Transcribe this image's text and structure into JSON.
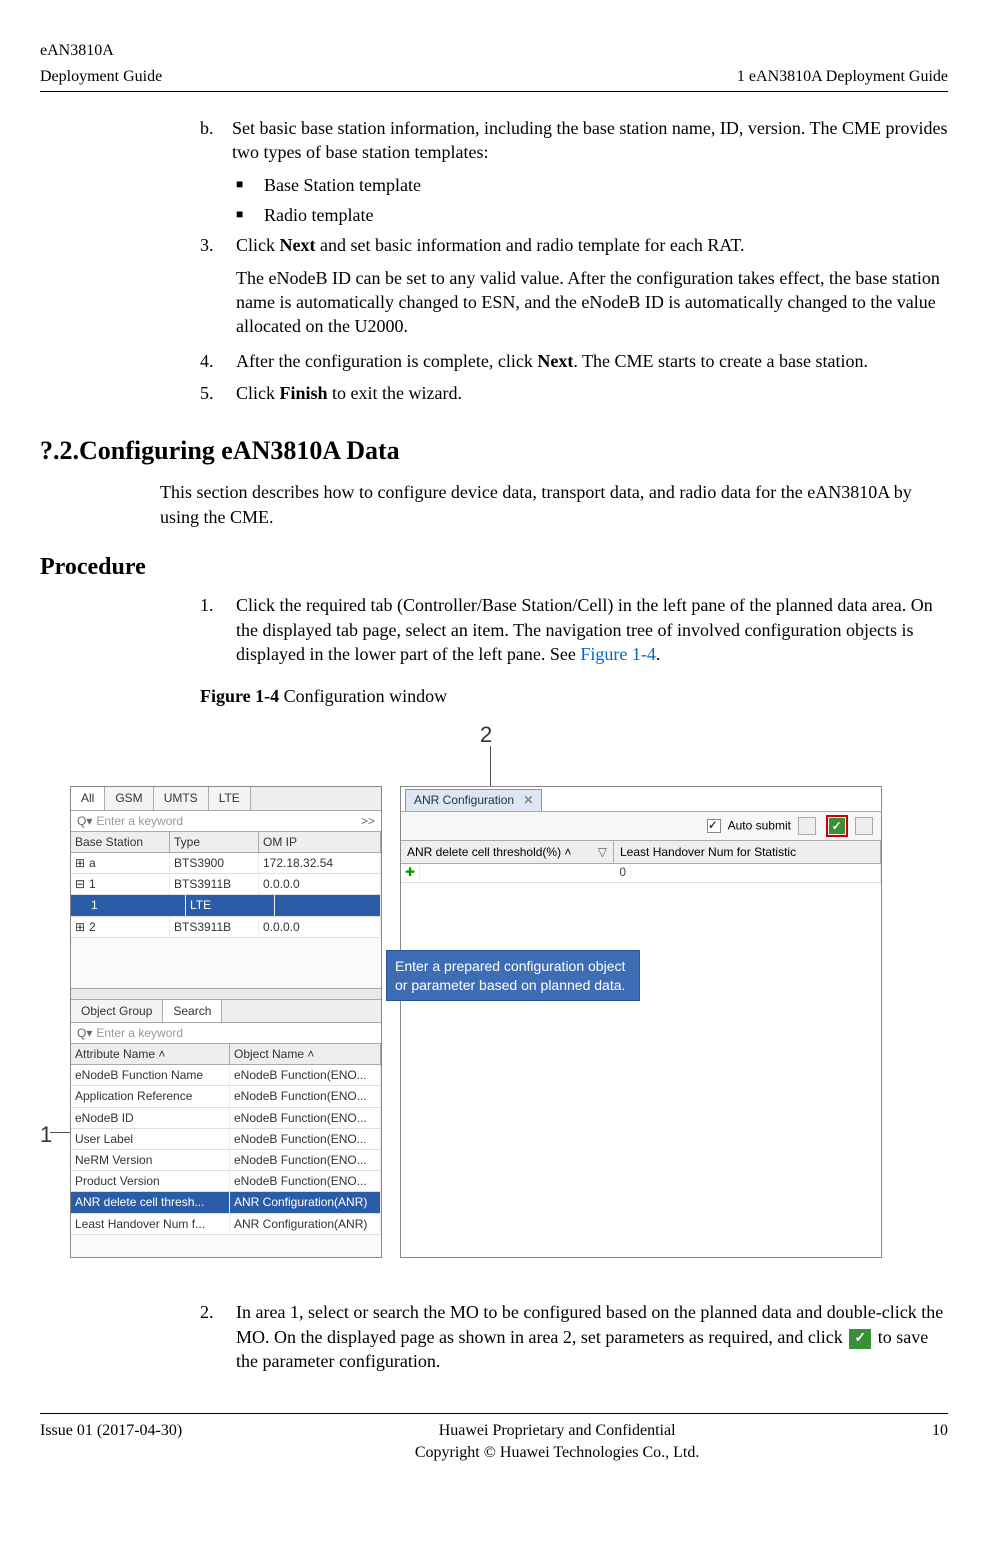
{
  "header": {
    "left_top": "eAN3810A",
    "left_bottom": "Deployment Guide",
    "right": "1 eAN3810A Deployment Guide"
  },
  "content": {
    "item_b": "Set basic base station information, including the base station name, ID, version. The CME provides two types of base station templates:",
    "bullet1": "Base Station template",
    "bullet2": "Radio template",
    "step3_pre": "Click ",
    "step3_bold": "Next",
    "step3_post": " and set basic information and radio template for each RAT.",
    "step3_para": "The eNodeB ID can be set to any valid value. After the configuration takes effect, the base station name is automatically changed to ESN, and the eNodeB ID is automatically changed to the value allocated on the U2000.",
    "step4_pre": "After the configuration is complete, click ",
    "step4_bold": "Next",
    "step4_post": ". The CME starts to create a base station.",
    "step5_pre": "Click ",
    "step5_bold": "Finish",
    "step5_post": " to exit the wizard."
  },
  "section2": {
    "heading": "?.2.Configuring eAN3810A Data",
    "para": "This section describes how to configure device data, transport data, and radio data for the eAN3810A by using the CME."
  },
  "procedure": {
    "heading": "Procedure",
    "step1": "Click the required tab (Controller/Base Station/Cell) in the left pane of the planned data area. On the displayed tab page, select an item. The navigation tree of involved configuration objects is displayed in the lower part of the left pane. See ",
    "step1_link": "Figure 1-4",
    "step1_post": ".",
    "fig_caption_bold": "Figure 1-4",
    "fig_caption_rest": " Configuration window",
    "step2_a": "In area 1, select or search the MO to be configured based on the planned data and double-click the MO. On the displayed page as shown in area 2, set parameters as required, and click ",
    "step2_b": "to save the parameter configuration."
  },
  "figure": {
    "tabs": {
      "all": "All",
      "gsm": "GSM",
      "umts": "UMTS",
      "lte": "LTE"
    },
    "search_q": "Q▾",
    "search_ph": "Enter a keyword",
    "expand": ">>",
    "cols": {
      "bs": "Base Station",
      "type": "Type",
      "omip": "OM IP"
    },
    "rows": [
      {
        "bs": "a",
        "type": "BTS3900",
        "ip": "172.18.32.54"
      },
      {
        "bs": "1",
        "type": "BTS3911B",
        "ip": "0.0.0.0"
      },
      {
        "bs": "1",
        "type": "LTE",
        "ip": ""
      },
      {
        "bs": "2",
        "type": "BTS3911B",
        "ip": "0.0.0.0"
      }
    ],
    "bottom_tabs": {
      "og": "Object Group",
      "search": "Search"
    },
    "attr_cols": {
      "a": "Attribute Name ˄",
      "o": "Object Name ˄"
    },
    "attr_rows": [
      {
        "a": "eNodeB Function Name",
        "o": "eNodeB Function(ENO..."
      },
      {
        "a": "Application Reference",
        "o": "eNodeB Function(ENO..."
      },
      {
        "a": "eNodeB ID",
        "o": "eNodeB Function(ENO..."
      },
      {
        "a": "User Label",
        "o": "eNodeB Function(ENO..."
      },
      {
        "a": "NeRM Version",
        "o": "eNodeB Function(ENO..."
      },
      {
        "a": "Product Version",
        "o": "eNodeB Function(ENO..."
      },
      {
        "a": "ANR delete cell thresh...",
        "o": "ANR Configuration(ANR)"
      },
      {
        "a": "Least Handover Num f...",
        "o": "ANR Configuration(ANR)"
      }
    ],
    "right_tab": "ANR Configuration",
    "right_tab_x": "✕",
    "auto_submit": "Auto submit",
    "rc1": "ANR delete cell threshold(%) ˄",
    "rc2": "Least Handover Num for Statistic",
    "empty_val": "0",
    "callout": "Enter a prepared configuration object or parameter based on planned data.",
    "num1": "1",
    "num2": "2"
  },
  "footer": {
    "left": "Issue 01 (2017-04-30)",
    "center1": "Huawei Proprietary and Confidential",
    "center2": "Copyright © Huawei Technologies Co., Ltd.",
    "right": "10"
  }
}
